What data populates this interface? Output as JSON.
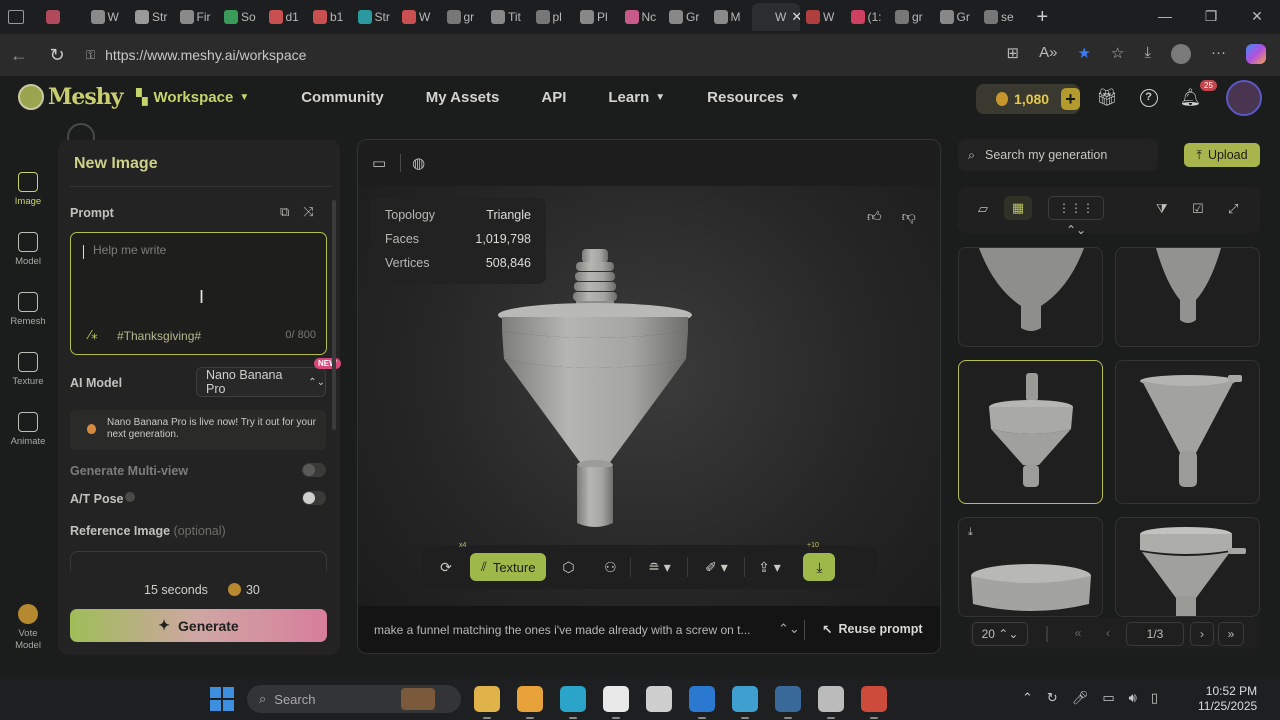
{
  "browser": {
    "tabs": [
      {
        "label": "",
        "color": "#b04a5a"
      },
      {
        "label": "W",
        "color": "#8a8a8a"
      },
      {
        "label": "Str",
        "color": "#9a9a9a"
      },
      {
        "label": "Fir",
        "color": "#8a8a8a"
      },
      {
        "label": "So",
        "color": "#3a9a5a"
      },
      {
        "label": "d1",
        "color": "#c85050"
      },
      {
        "label": "b1",
        "color": "#c85050"
      },
      {
        "label": "Str",
        "color": "#2a9aa0"
      },
      {
        "label": "W",
        "color": "#c85050"
      },
      {
        "label": "gr",
        "color": "#777777"
      },
      {
        "label": "Tit",
        "color": "#888888"
      },
      {
        "label": "pl",
        "color": "#777777"
      },
      {
        "label": "Pl",
        "color": "#888888"
      },
      {
        "label": "Nc",
        "color": "#c85a8a"
      },
      {
        "label": "Gr",
        "color": "#888888"
      },
      {
        "label": "M",
        "color": "#8a8a8a"
      },
      {
        "label": "W",
        "color": "#2c2d2e"
      },
      {
        "label": "W",
        "color": "#b04040"
      },
      {
        "label": "(1:",
        "color": "#d04060"
      },
      {
        "label": "gr",
        "color": "#777777"
      },
      {
        "label": "Gr",
        "color": "#888888"
      },
      {
        "label": "se",
        "color": "#777777"
      }
    ],
    "active_tab_index": 16,
    "url": "https://www.meshy.ai/workspace",
    "window_controls": [
      "—",
      "❐",
      "✕"
    ]
  },
  "header": {
    "logo": "Meshy",
    "nav": [
      {
        "label": "Workspace",
        "dropdown": true
      },
      {
        "label": "Community",
        "dropdown": false
      },
      {
        "label": "My Assets",
        "dropdown": false
      },
      {
        "label": "API",
        "dropdown": false
      },
      {
        "label": "Learn",
        "dropdown": true
      },
      {
        "label": "Resources",
        "dropdown": true
      }
    ],
    "credits": "1,080",
    "notification_count": "25",
    "icons": [
      "gift-icon",
      "help-icon",
      "bell-icon"
    ]
  },
  "rail": [
    {
      "label": "Image",
      "icon": "image-ai-icon",
      "active": true
    },
    {
      "label": "Model",
      "icon": "cube-icon",
      "active": false
    },
    {
      "label": "Remesh",
      "icon": "mesh-icon",
      "active": false
    },
    {
      "label": "Texture",
      "icon": "texture-icon",
      "active": false
    },
    {
      "label": "Animate",
      "icon": "running-figure-icon",
      "active": false
    }
  ],
  "vote": {
    "label_line1": "Vote",
    "label_line2": "Model"
  },
  "panel": {
    "title": "New Image",
    "prompt_label": "Prompt",
    "prompt_placeholder": "Help me write",
    "prompt_tag": "#Thanksgiving#",
    "char_count": "0/ 800",
    "ai_model_label": "AI Model",
    "ai_model_value": "Nano Banana Pro",
    "new_badge": "NEW",
    "notice": "Nano Banana Pro is live now! Try it out for your next generation.",
    "multiview_label": "Generate Multi-view",
    "pose_label": "A/T Pose",
    "reference_label": "Reference Image",
    "reference_optional": "(optional)",
    "gen_time": "15 seconds",
    "gen_cost": "30",
    "generate_label": "Generate"
  },
  "viewer": {
    "stats": [
      {
        "label": "Topology",
        "value": "Triangle"
      },
      {
        "label": "Faces",
        "value": "1,019,798"
      },
      {
        "label": "Vertices",
        "value": "508,846"
      }
    ],
    "toolbar": {
      "texture_label": "Texture",
      "x4_badge": "x4",
      "plus10_badge": "+10"
    },
    "prompt_text": "make a funnel matching the ones i've made already with a screw on t...",
    "reuse_label": "Reuse prompt"
  },
  "right": {
    "search_placeholder": "Search my generation",
    "upload_label": "Upload",
    "page_size": "20",
    "page": "1/3",
    "selected_card_index": 2
  },
  "taskbar": {
    "search_placeholder": "Search",
    "time": "10:52 PM",
    "date": "11/25/2025",
    "apps": [
      {
        "icon": "file-explorer-icon",
        "color": "#e0b24a",
        "running": true
      },
      {
        "icon": "store-icon",
        "color": "#e8a23a",
        "running": true
      },
      {
        "icon": "edge-icon",
        "color": "#2aa4c8",
        "running": true
      },
      {
        "icon": "amazon-icon",
        "color": "#e8e8e8",
        "running": true
      },
      {
        "icon": "bolt-app-icon",
        "color": "#cfcfcf",
        "running": false
      },
      {
        "icon": "outlook-icon",
        "color": "#2a78d0",
        "running": true
      },
      {
        "icon": "notepad-icon",
        "color": "#3fa0d0",
        "running": true
      },
      {
        "icon": "steam-icon",
        "color": "#3a6a9a",
        "running": true
      },
      {
        "icon": "game-icon",
        "color": "#bbbbbb",
        "running": true
      },
      {
        "icon": "chrome-icon",
        "color": "#cc4b3a",
        "running": true
      }
    ]
  }
}
